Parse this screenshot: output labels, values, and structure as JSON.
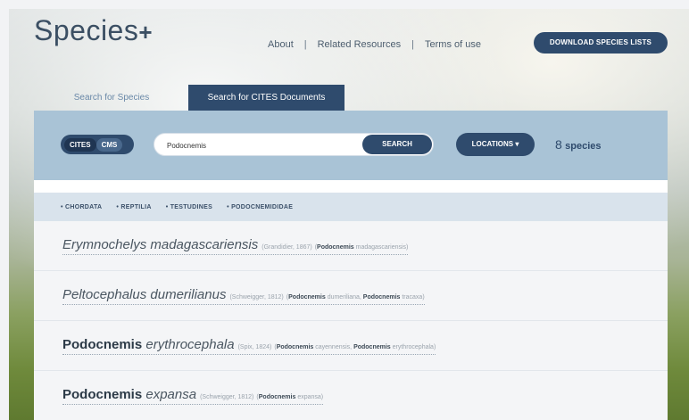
{
  "header": {
    "logo_text": "Species",
    "logo_plus": "+",
    "nav": [
      "About",
      "Related Resources",
      "Terms of use"
    ],
    "download_label": "DOWNLOAD SPECIES LISTS"
  },
  "tabs": {
    "species_label": "Search for Species",
    "cites_label": "Search for CITES Documents"
  },
  "search": {
    "toggle_cites": "CITES",
    "toggle_cms": "CMS",
    "query": "Podocnemis",
    "search_label": "SEARCH",
    "locations_label": "LOCATIONS",
    "count_number": "8",
    "count_word": "species"
  },
  "breadcrumb": [
    "CHORDATA",
    "REPTILIA",
    "TESTUDINES",
    "PODOCNEMIDIDAE"
  ],
  "results": [
    {
      "genus": "Erymnochelys",
      "epithet": "madagascariensis",
      "genus_bold": false,
      "author": "(Grandidier, 1867)",
      "syn_open": "(",
      "syn1_bold": "Podocnemis",
      "syn1_rest": " madagascariensis",
      "syn_sep": "",
      "syn2_bold": "",
      "syn2_rest": "",
      "syn_close": ")"
    },
    {
      "genus": "Peltocephalus",
      "epithet": "dumerilianus",
      "genus_bold": false,
      "author": "(Schweigger, 1812)",
      "syn_open": "(",
      "syn1_bold": "Podocnemis",
      "syn1_rest": " dumeriliana",
      "syn_sep": ", ",
      "syn2_bold": "Podocnemis",
      "syn2_rest": " tracaxa",
      "syn_close": ")"
    },
    {
      "genus": "Podocnemis",
      "epithet": "erythrocephala",
      "genus_bold": true,
      "author": "(Spix, 1824)",
      "syn_open": "(",
      "syn1_bold": "Podocnemis",
      "syn1_rest": " cayennensis",
      "syn_sep": ", ",
      "syn2_bold": "Podocnemis",
      "syn2_rest": " erythrocephala",
      "syn_close": ")"
    },
    {
      "genus": "Podocnemis",
      "epithet": "expansa",
      "genus_bold": true,
      "author": "(Schweigger, 1812)",
      "syn_open": "(",
      "syn1_bold": "Podocnemis",
      "syn1_rest": " expansa",
      "syn_sep": "",
      "syn2_bold": "",
      "syn2_rest": "",
      "syn_close": ")"
    }
  ]
}
